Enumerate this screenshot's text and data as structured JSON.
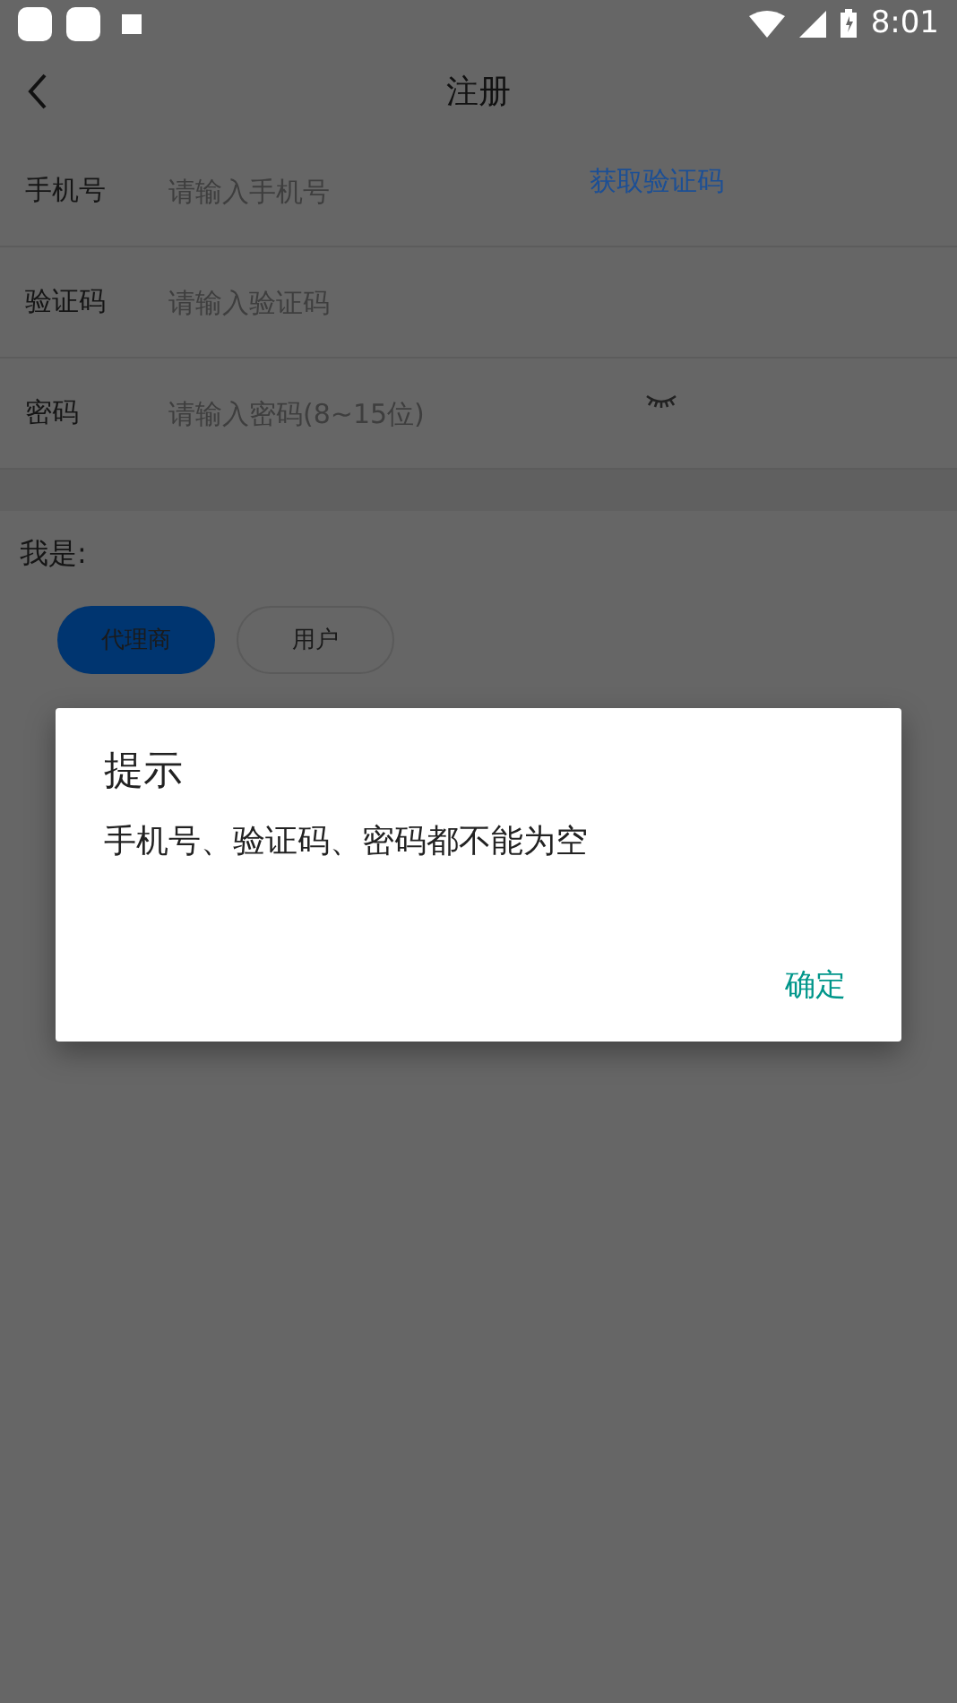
{
  "status_bar": {
    "time": "8:01"
  },
  "header": {
    "title": "注册"
  },
  "fields": [
    {
      "kind": "code",
      "label": "手机号",
      "placeholder": "请输入手机号",
      "action": "获取验证码"
    },
    {
      "kind": "plain",
      "label": "验证码",
      "placeholder": "请输入验证码"
    },
    {
      "kind": "password",
      "label": "密码",
      "placeholder": "请输入密码(8~15位)"
    }
  ],
  "role": {
    "label": "我是:",
    "options": [
      {
        "label": "代理商",
        "selected": true
      },
      {
        "label": "用户",
        "selected": false
      }
    ]
  },
  "dialog": {
    "title": "提示",
    "message": "手机号、验证码、密码都不能为空",
    "button": "确定"
  }
}
